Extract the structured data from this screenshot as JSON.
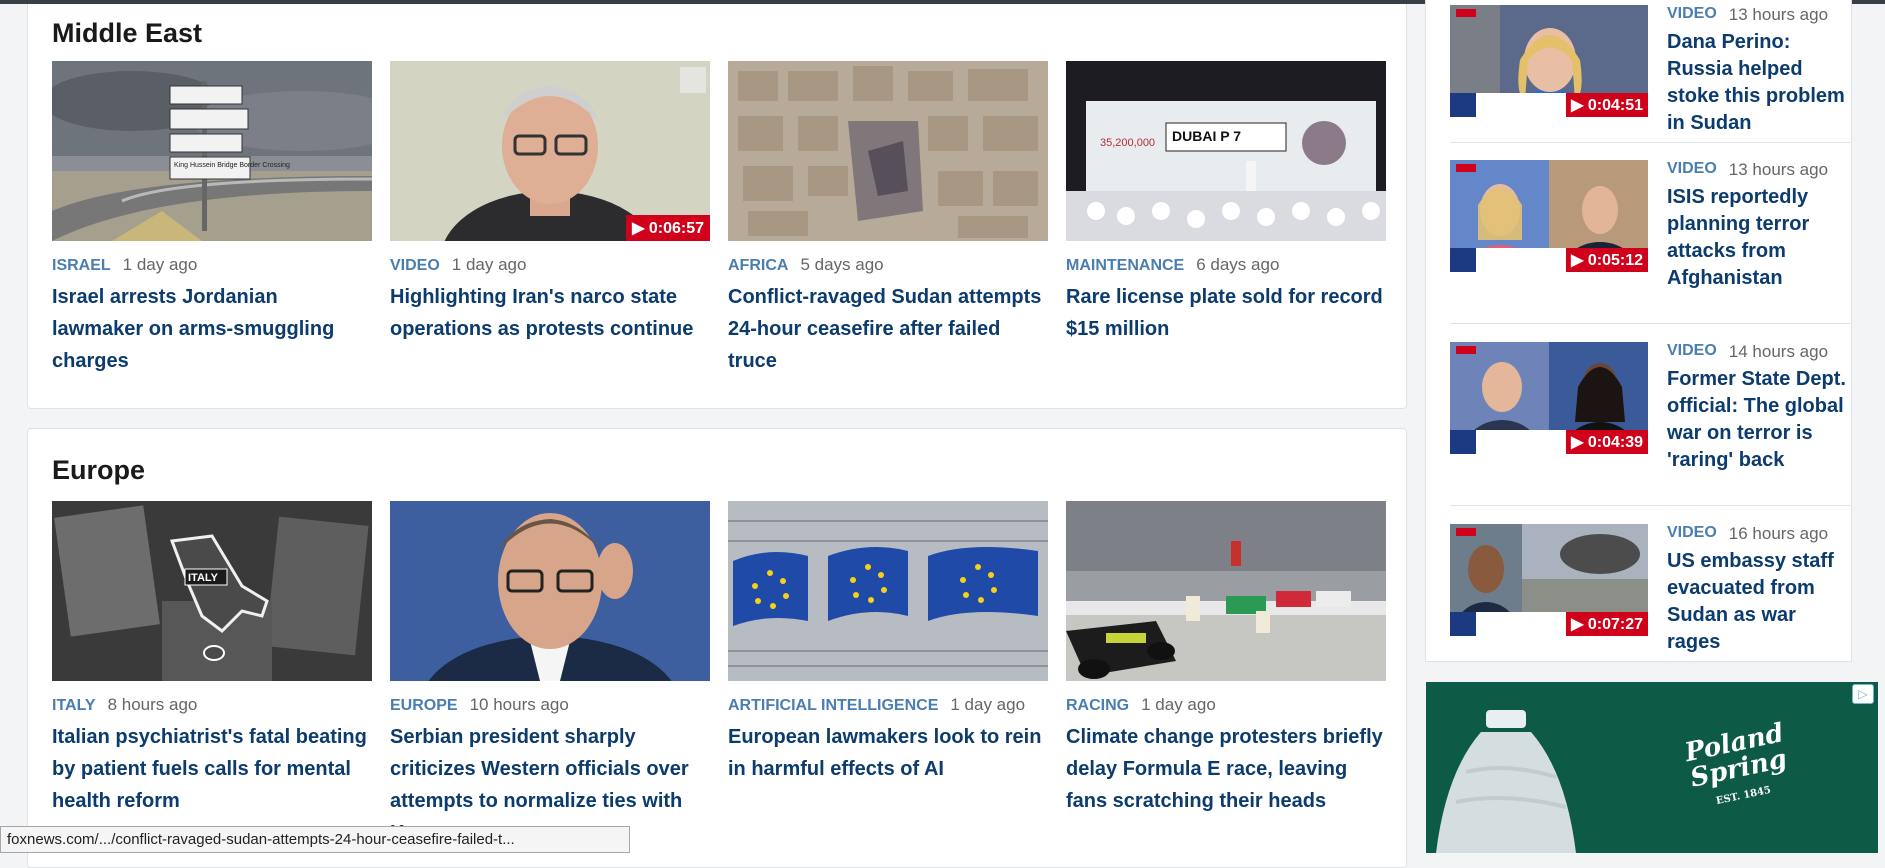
{
  "sections": [
    {
      "title": "Middle East",
      "cards": [
        {
          "kicker": "ISRAEL",
          "ago": "1 day ago",
          "headline": "Israel arrests Jordanian lawmaker on arms-smuggling charges",
          "duration": ""
        },
        {
          "kicker": "VIDEO",
          "ago": "1 day ago",
          "headline": "Highlighting Iran's narco state operations as protests continue",
          "duration": "▶ 0:06:57"
        },
        {
          "kicker": "AFRICA",
          "ago": "5 days ago",
          "headline": "Conflict-ravaged Sudan attempts 24-hour ceasefire after failed truce",
          "duration": ""
        },
        {
          "kicker": "MAINTENANCE",
          "ago": "6 days ago",
          "headline": "Rare license plate sold for record $15 million",
          "duration": ""
        }
      ]
    },
    {
      "title": "Europe",
      "cards": [
        {
          "kicker": "ITALY",
          "ago": "8 hours ago",
          "headline": "Italian psychiatrist's fatal beating by patient fuels calls for mental health reform",
          "duration": ""
        },
        {
          "kicker": "EUROPE",
          "ago": "10 hours ago",
          "headline": "Serbian president sharply criticizes Western officials over attempts to normalize ties with Kosovo",
          "duration": ""
        },
        {
          "kicker": "ARTIFICIAL INTELLIGENCE",
          "ago": "1 day ago",
          "headline": "European lawmakers look to rein in harmful effects of AI",
          "duration": ""
        },
        {
          "kicker": "RACING",
          "ago": "1 day ago",
          "headline": "Climate change protesters briefly delay Formula E race, leaving fans scratching their heads",
          "duration": ""
        }
      ]
    }
  ],
  "sidebar_videos": [
    {
      "kicker": "VIDEO",
      "ago": "13 hours ago",
      "headline": "Dana Perino: Russia helped stoke this problem in Sudan",
      "duration": "▶ 0:04:51"
    },
    {
      "kicker": "VIDEO",
      "ago": "13 hours ago",
      "headline": "ISIS reportedly planning terror attacks from Afghanistan",
      "duration": "▶ 0:05:12"
    },
    {
      "kicker": "VIDEO",
      "ago": "14 hours ago",
      "headline": "Former State Dept. official: The global war on terror is 'raring' back",
      "duration": "▶ 0:04:39"
    },
    {
      "kicker": "VIDEO",
      "ago": "16 hours ago",
      "headline": "US embassy staff evacuated from Sudan as war rages",
      "duration": "▶ 0:07:27"
    }
  ],
  "image_text": {
    "italy_map_label": "ITALY",
    "plate_text": "DUBAI P 7",
    "plate_price": "35,200,000",
    "road_sign": "King Hussein Bridge Border Crossing"
  },
  "ad": {
    "brand_line1": "Poland",
    "brand_line2": "Spring",
    "est": "EST. 1845",
    "badge": "▷"
  },
  "status_bar": {
    "url": "foxnews.com/.../conflict-ravaged-sudan-attempts-24-hour-ceasefire-failed-t..."
  },
  "colors": {
    "kicker": "#4a7eb0",
    "headline": "#0c3b6e",
    "duration_badge": "#d0021b",
    "ad_bg": "#0d5a46"
  }
}
